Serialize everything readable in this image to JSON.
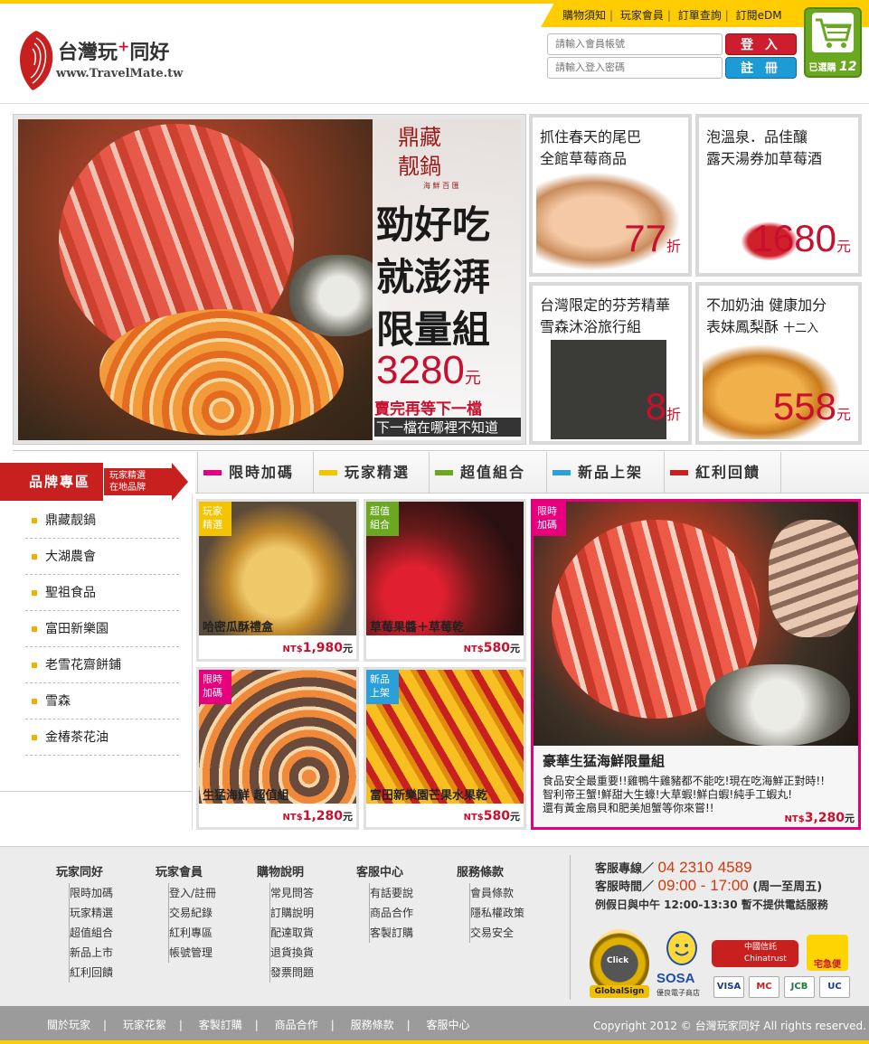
{
  "header": {
    "top_links": [
      "購物須知",
      "玩家會員",
      "訂單查詢",
      "訂閱eDM"
    ],
    "logo_title": "台灣玩",
    "logo_plus": "+",
    "logo_title2": "同好",
    "logo_url": "www.TravelMate.tw",
    "account_placeholder": "請輸入會員帳號",
    "password_placeholder": "請輸入登入密碼",
    "login_label": "登 入",
    "register_label": "註 冊",
    "cart_label": "已選購",
    "cart_count": "12"
  },
  "hero": {
    "title1": "鼎藏",
    "title2": "靓鍋",
    "subtitle": "海 鮮 百 匯",
    "headline": "勁好吃就澎湃限量組",
    "price": "3280",
    "unit": "元",
    "line1": "賣完再等下一檔",
    "line2": "下一檔在哪裡不知道"
  },
  "promos": [
    {
      "line1": "抓住春天的尾巴",
      "line2": "全館草莓商品",
      "line2_small": "",
      "value": "77",
      "unit": "折"
    },
    {
      "line1": "泡溫泉．品佳釀",
      "line2": "露天湯券加草莓酒",
      "line2_small": "",
      "value": "1680",
      "unit": "元"
    },
    {
      "line1": "台灣限定的芬芳精華",
      "line2": "雪森沐浴旅行組",
      "line2_small": "",
      "value": "8",
      "unit": "折"
    },
    {
      "line1": "不加奶油 健康加分",
      "line2": "表妹鳳梨酥 ",
      "line2_small": "十二入",
      "value": "558",
      "unit": "元"
    }
  ],
  "brand_zone": {
    "title": "品牌專區",
    "sub1": "玩家精選",
    "sub2": "在地品牌"
  },
  "categories": [
    {
      "label": "限時加碼",
      "color": "#e6007e"
    },
    {
      "label": "玩家精選",
      "color": "#f5c400"
    },
    {
      "label": "超值組合",
      "color": "#6aa821"
    },
    {
      "label": "新品上架",
      "color": "#2a9fd8"
    },
    {
      "label": "紅利回饋",
      "color": "#c8201e"
    }
  ],
  "brands": [
    "鼎藏靓鍋",
    "大湖農會",
    "聖祖食品",
    "富田新樂園",
    "老雪花齋餅鋪",
    "雪森",
    "金椿茶花油"
  ],
  "products": [
    {
      "tag1": "玩家",
      "tag2": "精選",
      "tag_color": "#f5c400",
      "name": "哈密瓜酥禮盒",
      "currency": "NT$",
      "price": "1,980",
      "unit": "元"
    },
    {
      "tag1": "超值",
      "tag2": "組合",
      "tag_color": "#6aa821",
      "name": "草莓果醬＋草莓乾",
      "currency": "NT$",
      "price": "580",
      "unit": "元"
    },
    {
      "tag1": "限時",
      "tag2": "加碼",
      "tag_color": "#e6007e",
      "name": "生猛海鮮 超值組",
      "currency": "NT$",
      "price": "1,280",
      "unit": "元"
    },
    {
      "tag1": "新品",
      "tag2": "上架",
      "tag_color": "#2a9fd8",
      "name": "富田新樂園芒果水果乾",
      "currency": "NT$",
      "price": "580",
      "unit": "元"
    }
  ],
  "featured": {
    "tag1": "限時",
    "tag2": "加碼",
    "title": "豪華生猛海鮮限量組",
    "desc1": "食品安全最重要!!雞鴨牛雞豬都不能吃!現在吃海鮮正對時!!",
    "desc2": "智利帝王蟹!鮮甜大生蠔!大草蝦!鮮白蝦!純手工蝦丸!",
    "desc3": "還有黃金扇貝和肥美旭蟹等你來嘗!!",
    "currency": "NT$",
    "price": "3,280",
    "unit": "元"
  },
  "footer": {
    "columns": [
      {
        "title": "玩家同好",
        "items": [
          "限時加碼",
          "玩家精選",
          "超值組合",
          "新品上市",
          "紅利回饋"
        ]
      },
      {
        "title": "玩家會員",
        "items": [
          "登入/註冊",
          "交易紀錄",
          "紅利專區",
          "帳號管理"
        ]
      },
      {
        "title": "購物說明",
        "items": [
          "常見問答",
          "訂購說明",
          "配達取貨",
          "退貨換貨",
          "發票問題"
        ]
      },
      {
        "title": "客服中心",
        "items": [
          "有話要說",
          "商品合作",
          "客製訂購"
        ]
      },
      {
        "title": "服務條款",
        "items": [
          "會員條款",
          "隱私權政策",
          "交易安全"
        ]
      }
    ],
    "hotline_label": "客服專線／",
    "hotline": "04 2310 4589",
    "hours_label": "客服時間／",
    "hours": "09:00 - 17:00",
    "hours_note": "(周一至周五)",
    "holiday_note": "例假日與中午 12:00-13:30 暫不提供電話服務",
    "badges": {
      "check": "Click",
      "globalsign": "GlobalSign",
      "sosa": "SOSA",
      "sosa_sub": "優良電子商店",
      "chinatrust1": "中國信託",
      "chinatrust2": "Chinatrust",
      "tmall": "宅急便"
    },
    "cards": [
      "VISA",
      "MC",
      "JCB",
      "UC"
    ],
    "bottom_links": [
      "關於玩家",
      "玩家花絮",
      "客製訂購",
      "商品合作",
      "服務條款",
      "客服中心"
    ],
    "copyright": "Copyright 2012 © 台灣玩家同好 All rights reserved."
  }
}
